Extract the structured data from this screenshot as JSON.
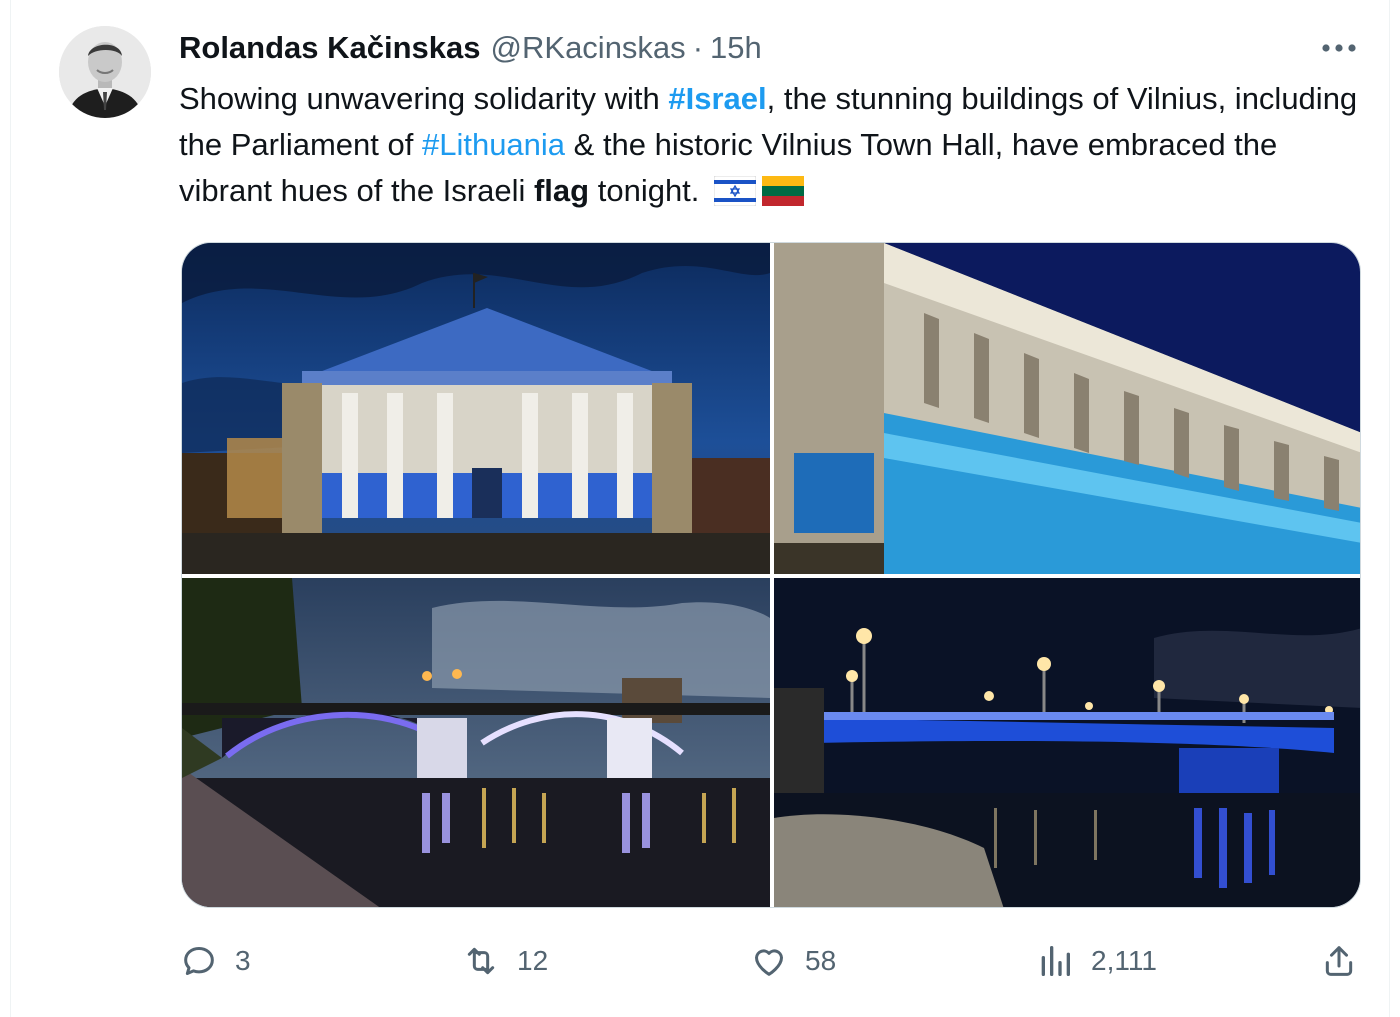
{
  "tweet": {
    "author_name": "Rolandas Kačinskas",
    "handle": "@RKacinskas",
    "separator": "·",
    "time": "15h",
    "text": {
      "p1": "Showing unwavering solidarity with ",
      "tag1": "#Israel",
      "p2": ", the stunning buildings of Vilnius, including the Parliament of ",
      "tag2": "#Lithuania",
      "p3": " & the historic Vilnius Town Hall, have embraced the vibrant hues of the Israeli ",
      "bold_word": "flag",
      "p4": " tonight."
    },
    "flags": [
      "israel-flag-emoji",
      "lithuania-flag-emoji"
    ],
    "media": [
      "vilnius-town-hall-photo",
      "parliament-building-photo",
      "white-bridge-photo",
      "blue-bridge-photo"
    ]
  },
  "actions": {
    "replies": "3",
    "retweets": "12",
    "likes": "58",
    "views": "2,111"
  },
  "colors": {
    "link": "#1d9bf0",
    "secondary_text": "#536471",
    "border": "#cfd9de"
  }
}
